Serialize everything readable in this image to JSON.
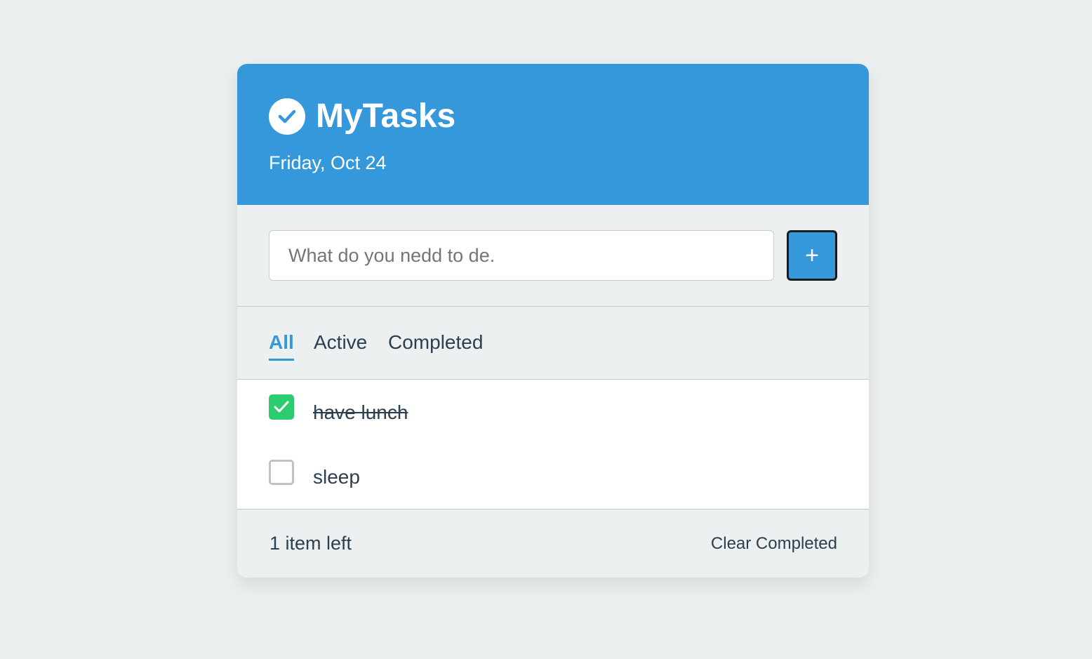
{
  "app": {
    "title": "MyTasks",
    "date": "Friday, Oct 24",
    "accent_color": "#3598db",
    "logo_icon": "check-circle-icon"
  },
  "new_task": {
    "value": "",
    "placeholder": "What do you nedd to de.",
    "add_label": "+"
  },
  "filters": {
    "active_tab": "All",
    "tabs": [
      "All",
      "Active",
      "Completed"
    ]
  },
  "tasks": [
    {
      "text": "have lunch",
      "completed": true
    },
    {
      "text": "sleep",
      "completed": false
    }
  ],
  "footer": {
    "items_left": "1 item left",
    "clear_label": "Clear Completed"
  },
  "colors": {
    "completed_check": "#2ecc71",
    "text": "#2c3e50",
    "background": "#ecf0f1"
  }
}
